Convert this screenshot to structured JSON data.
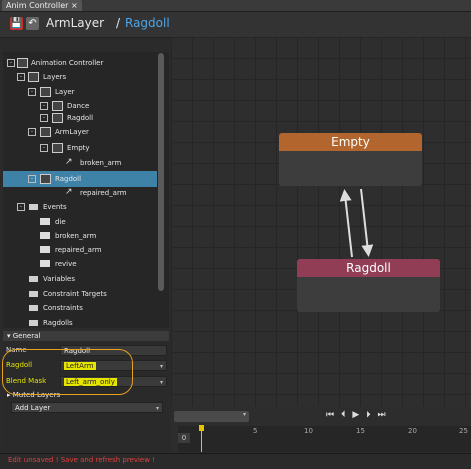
{
  "tab": {
    "title": "Anim Controller",
    "close": "×"
  },
  "header": {
    "breadcrumb_parent": "ArmLayer",
    "separator": "/",
    "breadcrumb_current": "Ragdoll"
  },
  "tree": {
    "root": "Animation Controller",
    "layers": "Layers",
    "layer": "Layer",
    "dance": "Dance",
    "ragdoll_state": "Ragdoll",
    "armlayer": "ArmLayer",
    "empty": "Empty",
    "broken_arm_transition": "broken_arm",
    "ragdoll_selected": "Ragdoll",
    "repaired_arm_transition": "repaired_arm",
    "events": "Events",
    "event_die": "die",
    "event_broken_arm": "broken_arm",
    "event_repaired_arm": "repaired_arm",
    "event_revive": "revive",
    "variables": "Variables",
    "constraint_targets": "Constraint Targets",
    "constraints": "Constraints",
    "ragdolls": "Ragdolls"
  },
  "properties": {
    "general_section": "General",
    "name_label": "Name",
    "name_value": "Ragdoll",
    "ragdoll_label": "Ragdoll",
    "ragdoll_value": "LeftArm",
    "blend_mask_label": "Blend Mask",
    "blend_mask_value": "Left_arm_only",
    "muted_layers_section": "Muted Layers",
    "add_layer_label": "Add Layer"
  },
  "graph": {
    "node_empty": "Empty",
    "node_ragdoll": "Ragdoll",
    "empty_header_color": "#b2652c",
    "ragdoll_header_color": "#913d55"
  },
  "timeline": {
    "controls": "⏮ ⏴ ▶ ⏵ ⏭",
    "frame_start": "0",
    "ticks": [
      "5",
      "10",
      "15",
      "20",
      "25"
    ]
  },
  "status": {
    "message": "Edit unsaved ! Save and refresh preview !"
  }
}
